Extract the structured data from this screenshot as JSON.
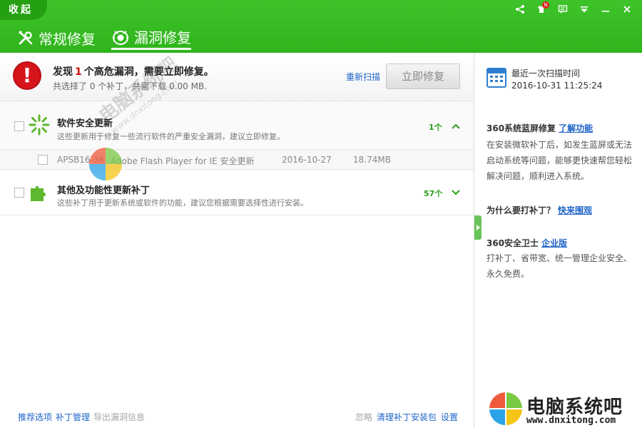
{
  "header": {
    "collapse_label": "收起",
    "notice_badge": "N",
    "tabs": [
      {
        "label": "常规修复",
        "icon": "wrench-icon"
      },
      {
        "label": "漏洞修复",
        "icon": "shield-bug-icon",
        "active": true
      }
    ]
  },
  "alert": {
    "title_prefix": "发现",
    "count": "1",
    "title_suffix": "个高危漏洞，需要立即修复。",
    "subtitle": "共选择了 0 个补丁，共需下载 0.00 MB.",
    "rescan_label": "重新扫描",
    "fix_button": "立即修复"
  },
  "groups": [
    {
      "title": "软件安全更新",
      "desc": "这些更新用于修复一些流行软件的严重安全漏洞，建议立即修复。",
      "count": "1个",
      "expanded": true,
      "items": [
        {
          "id": "APSB16-36",
          "name": "Adobe Flash Player for IE 安全更新",
          "date": "2016-10-27",
          "size": "18.74MB"
        }
      ]
    },
    {
      "title": "其他及功能性更新补丁",
      "desc": "这些补丁用于更新系统或软件的功能，建议您根据需要选择性进行安装。",
      "count": "57个",
      "expanded": false
    }
  ],
  "footer": {
    "left": [
      "推荐选项",
      "补丁管理",
      "导出漏洞信息"
    ],
    "right": [
      "忽略",
      "清理补丁安装包",
      "设置"
    ]
  },
  "side": {
    "scan_label": "最近一次扫描时间",
    "scan_time": "2016-10-31 11:25:24",
    "sec1_title": "360系统蓝屏修复",
    "sec1_link": "了解功能",
    "sec1_body": "在安装微软补丁后，如发生蓝屏或无法启动系统等问题，能够更快速帮您轻松解决问题，顺利进入系统。",
    "sec2_title": "为什么要打补丁？",
    "sec2_link": "快来围观",
    "sec3_title": "360安全卫士",
    "sec3_link": "企业版",
    "sec3_body": "打补丁、省带宽、统一管理企业安全、永久免费。"
  },
  "watermark": {
    "brand": "电脑系统吧",
    "url": "www.dnxitong.com",
    "diag_text": "电脑系统吧",
    "diag_url": "www.dnxitong.com"
  },
  "colors": {
    "header_green": "#3fc32a",
    "alert_red": "#d6151b",
    "link_blue": "#1e63c8",
    "count_green": "#2a9f1a"
  }
}
